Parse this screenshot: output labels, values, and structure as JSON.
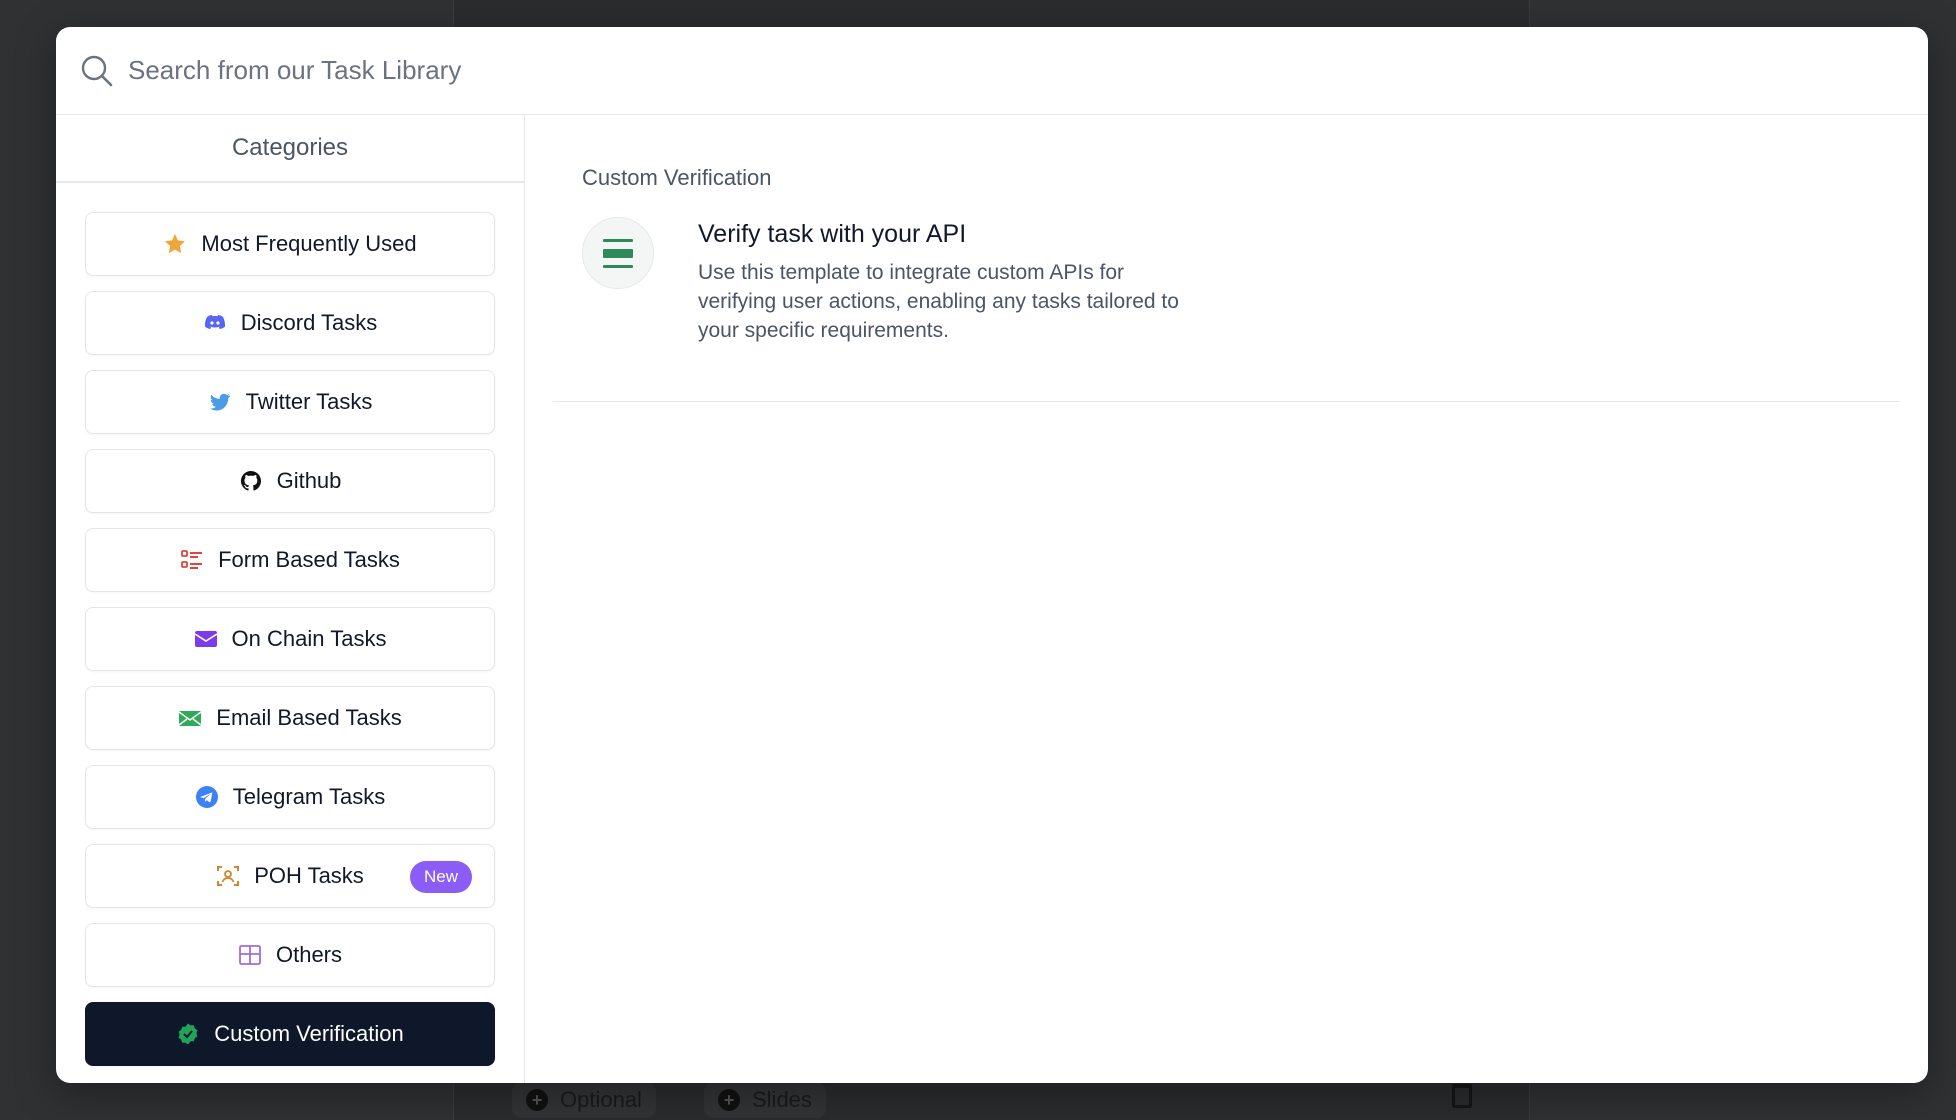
{
  "background": {
    "chips": [
      {
        "label": "Optional"
      },
      {
        "label": "Slides"
      }
    ]
  },
  "search": {
    "placeholder": "Search from our Task Library"
  },
  "sidebar": {
    "title": "Categories",
    "items": [
      {
        "label": "Most Frequently Used",
        "icon": "star-icon"
      },
      {
        "label": "Discord Tasks",
        "icon": "discord-icon"
      },
      {
        "label": "Twitter Tasks",
        "icon": "twitter-icon"
      },
      {
        "label": "Github",
        "icon": "github-icon"
      },
      {
        "label": "Form Based Tasks",
        "icon": "form-list-icon"
      },
      {
        "label": "On Chain Tasks",
        "icon": "wallet-icon"
      },
      {
        "label": "Email Based Tasks",
        "icon": "envelope-icon"
      },
      {
        "label": "Telegram Tasks",
        "icon": "telegram-icon"
      },
      {
        "label": "POH Tasks",
        "icon": "person-scan-icon",
        "badge": "New"
      },
      {
        "label": "Others",
        "icon": "grid-icon"
      },
      {
        "label": "Custom Verification",
        "icon": "verified-badge-icon",
        "active": true
      }
    ]
  },
  "content": {
    "section_title": "Custom Verification",
    "tasks": [
      {
        "title": "Verify task with your API",
        "description": "Use this template to integrate custom APIs for verifying user actions, enabling any tasks tailored to your specific requirements.",
        "icon": "api-server-icon"
      }
    ]
  },
  "colors": {
    "active_bg": "#0f172a",
    "badge": "#8b5cf6",
    "api_icon": "#2f8a5b",
    "overlay": "#303133"
  }
}
